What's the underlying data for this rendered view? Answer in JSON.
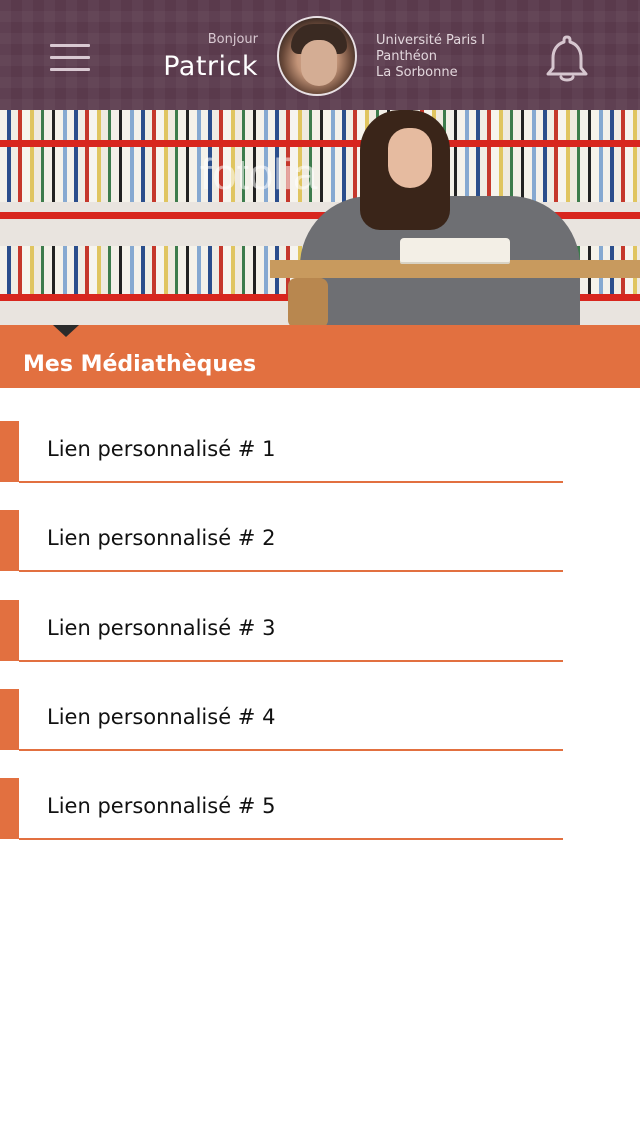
{
  "header": {
    "greeting": "Bonjour",
    "user_name": "Patrick",
    "university": [
      "Université Paris I",
      "Panthéon",
      "La Sorbonne"
    ],
    "icons": {
      "menu": "hamburger-icon",
      "notifications": "bell-icon",
      "avatar": "user-avatar"
    }
  },
  "banner": {
    "watermark": "fotolia"
  },
  "section": {
    "title": "Mes Médiathèques",
    "accent_color": "#e27040"
  },
  "links": [
    {
      "label": "Lien personnalisé # 1"
    },
    {
      "label": "Lien personnalisé # 2"
    },
    {
      "label": "Lien personnalisé # 3"
    },
    {
      "label": "Lien personnalisé # 4"
    },
    {
      "label": "Lien personnalisé # 5"
    }
  ],
  "colors": {
    "header_bg": "#5a3a4c",
    "accent": "#e27040",
    "text": "#111111"
  }
}
